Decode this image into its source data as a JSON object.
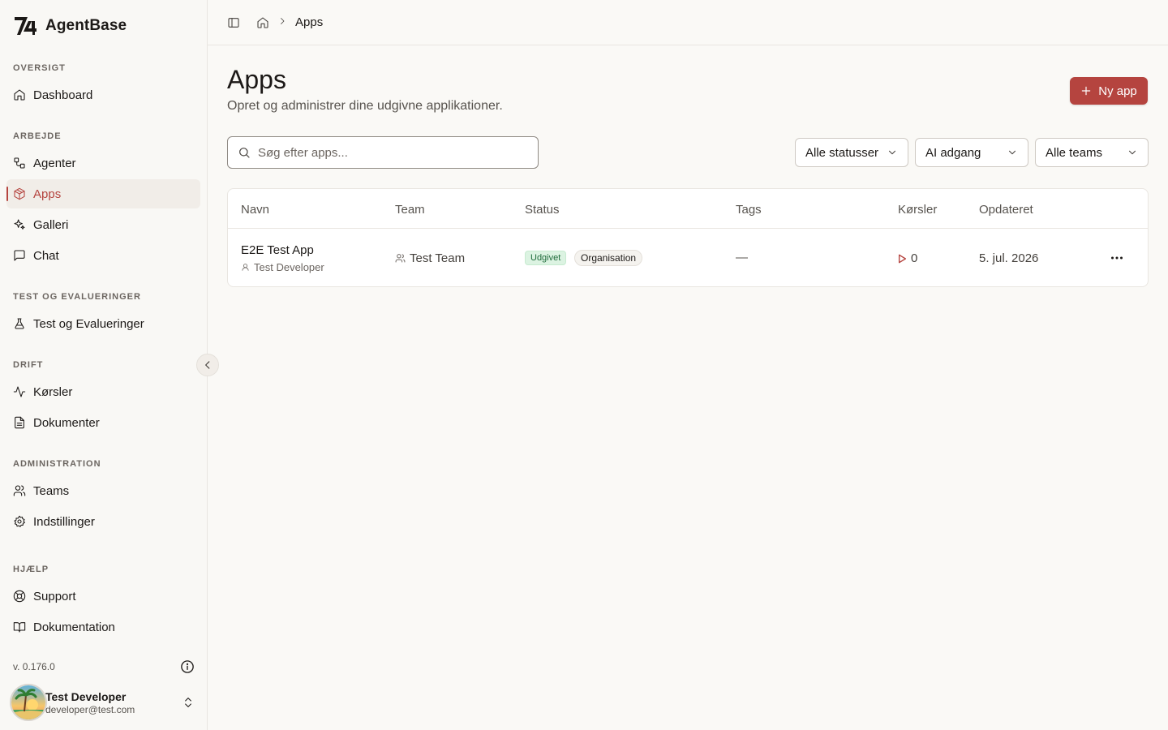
{
  "app": {
    "name": "AgentBase"
  },
  "sidebar": {
    "sections": [
      {
        "title": "OVERSIGT",
        "items": [
          {
            "label": "Dashboard",
            "icon": "home-icon"
          }
        ]
      },
      {
        "title": "ARBEJDE",
        "items": [
          {
            "label": "Agenter",
            "icon": "workflow-icon"
          },
          {
            "label": "Apps",
            "icon": "box-icon",
            "active": true
          },
          {
            "label": "Galleri",
            "icon": "sparkles-icon"
          },
          {
            "label": "Chat",
            "icon": "message-square-icon"
          }
        ]
      },
      {
        "title": "TEST OG EVALUERINGER",
        "items": [
          {
            "label": "Test og Evalueringer",
            "icon": "flask-icon"
          }
        ]
      },
      {
        "title": "DRIFT",
        "items": [
          {
            "label": "Kørsler",
            "icon": "activity-icon"
          },
          {
            "label": "Dokumenter",
            "icon": "file-text-icon"
          }
        ]
      },
      {
        "title": "ADMINISTRATION",
        "items": [
          {
            "label": "Teams",
            "icon": "users-icon"
          },
          {
            "label": "Indstillinger",
            "icon": "gear-icon"
          }
        ]
      },
      {
        "title": "HJÆLP",
        "items": [
          {
            "label": "Support",
            "icon": "life-buoy-icon"
          },
          {
            "label": "Dokumentation",
            "icon": "book-open-icon"
          }
        ]
      }
    ],
    "version": "v. 0.176.0",
    "user": {
      "name": "Test Developer",
      "email": "developer@test.com"
    }
  },
  "header": {
    "breadcrumb_current": "Apps"
  },
  "main": {
    "title": "Apps",
    "subtitle": "Opret og administrer dine udgivne applikationer.",
    "new_button": "Ny app",
    "search_placeholder": "Søg efter apps...",
    "filters": [
      "Alle statusser",
      "AI adgang",
      "Alle teams"
    ],
    "table": {
      "columns": [
        "Navn",
        "Team",
        "Status",
        "Tags",
        "Kørsler",
        "Opdateret"
      ],
      "rows": [
        {
          "name": "E2E Test App",
          "owner": "Test Developer",
          "team": "Test Team",
          "status": "Udgivet",
          "visibility": "Organisation",
          "tags": "—",
          "runs": "0",
          "updated": "5. jul. 2026"
        }
      ]
    }
  },
  "colors": {
    "accent": "#b5443f",
    "published_bg": "#dcf3e2",
    "published_text": "#1e6b3a"
  }
}
